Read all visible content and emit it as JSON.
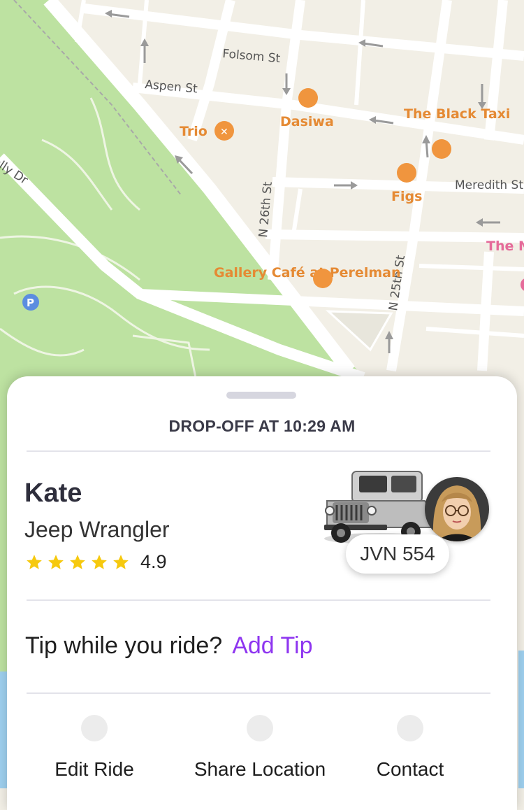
{
  "map": {
    "streets": [
      "Folsom St",
      "Aspen St",
      "N 26th St",
      "N 25th St",
      "Meredith St",
      "Kelly Dr"
    ],
    "places": [
      {
        "name": "Trio",
        "type": "restaurant"
      },
      {
        "name": "Dasiwa",
        "type": "food"
      },
      {
        "name": "The Black Taxi",
        "type": "bar"
      },
      {
        "name": "Figs",
        "type": "restaurant"
      },
      {
        "name": "Gallery Café at Perelman",
        "type": "cafe"
      },
      {
        "name": "The Nail L",
        "type": "shop"
      }
    ],
    "parking_label": "P",
    "colors": {
      "land": "#f2efe6",
      "park": "#bde2a1",
      "road": "#ffffff",
      "poi_orange": "#f0953e",
      "poi_pink": "#e56b9a"
    }
  },
  "sheet": {
    "dropoff_text": "DROP-OFF AT 10:29 AM",
    "driver": {
      "name": "Kate",
      "vehicle": "Jeep Wrangler",
      "rating": "4.9",
      "stars": 5,
      "plate": "JVN 554"
    },
    "tip": {
      "question": "Tip while you ride?",
      "link": "Add Tip",
      "link_color": "#8e35f0"
    },
    "actions": [
      {
        "label": "Edit Ride",
        "icon": "edit-icon"
      },
      {
        "label": "Share Location",
        "icon": "share-icon"
      },
      {
        "label": "Contact",
        "icon": "contact-icon"
      }
    ]
  }
}
